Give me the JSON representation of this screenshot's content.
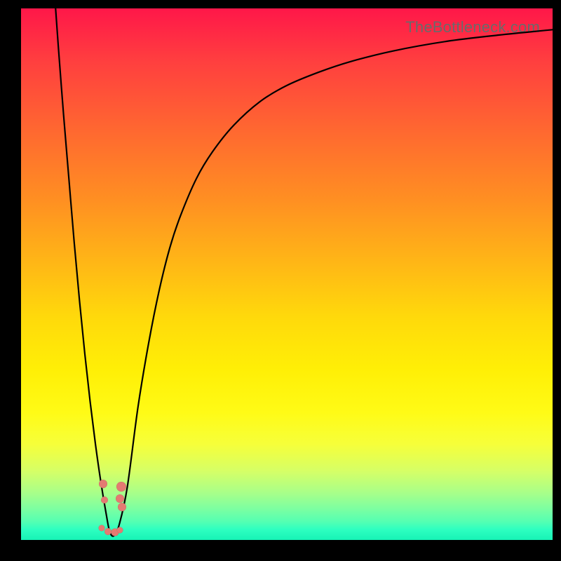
{
  "watermark": "TheBottleneck.com",
  "chart_data": {
    "type": "line",
    "title": "",
    "xlabel": "",
    "ylabel": "",
    "xlim": [
      0,
      100
    ],
    "ylim": [
      0,
      100
    ],
    "series": [
      {
        "name": "bottleneck-curve",
        "color": "#000000",
        "x": [
          6.5,
          7,
          8,
          9,
          10,
          11,
          12,
          13,
          14,
          15,
          16,
          16.7,
          17.5,
          18.5,
          20,
          22,
          24,
          26,
          28,
          30,
          33,
          36,
          40,
          45,
          50,
          56,
          62,
          70,
          80,
          90,
          100
        ],
        "values": [
          100,
          93,
          80,
          68,
          56,
          45,
          35,
          26,
          18,
          11,
          5,
          1.5,
          0.8,
          3,
          10,
          25,
          37,
          47,
          55,
          61,
          68,
          73,
          78,
          82.5,
          85.5,
          88,
          90,
          92,
          93.8,
          95,
          96
        ],
        "note": "y is bottleneck severity %, 0 = optimal (green), 100 = worst (red). Curve dips to ~0 near x≈17 then asymptotes toward ~96."
      }
    ],
    "markers": [
      {
        "x": 15.4,
        "y": 10.5,
        "r": 6
      },
      {
        "x": 15.7,
        "y": 7.5,
        "r": 5
      },
      {
        "x": 18.8,
        "y": 10.0,
        "r": 7
      },
      {
        "x": 18.6,
        "y": 7.8,
        "r": 6
      },
      {
        "x": 19.0,
        "y": 6.2,
        "r": 6
      },
      {
        "x": 15.2,
        "y": 2.2,
        "r": 4.5
      },
      {
        "x": 16.3,
        "y": 1.6,
        "r": 5
      },
      {
        "x": 17.7,
        "y": 1.5,
        "r": 5.5
      },
      {
        "x": 18.6,
        "y": 1.8,
        "r": 4.5
      }
    ],
    "background_gradient": {
      "top": "#ff1749",
      "bottom": "#17f3b6",
      "meaning": "red = high bottleneck, green = no bottleneck"
    }
  }
}
